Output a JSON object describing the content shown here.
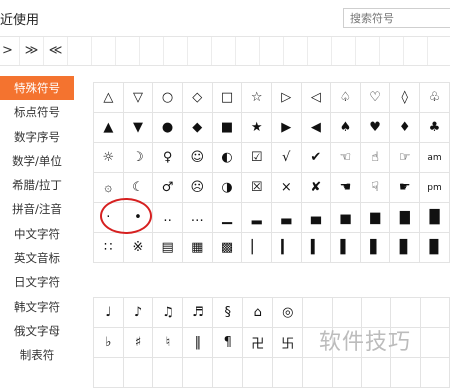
{
  "header": {
    "title": "近使用",
    "search_placeholder": "搜索符号"
  },
  "recent": [
    ">",
    "≫",
    "≪"
  ],
  "sidebar": [
    {
      "label": "特殊符号",
      "active": true
    },
    {
      "label": "标点符号"
    },
    {
      "label": "数字序号"
    },
    {
      "label": "数学/单位"
    },
    {
      "label": "希腊/拉丁"
    },
    {
      "label": "拼音/注音"
    },
    {
      "label": "中文字符"
    },
    {
      "label": "英文音标"
    },
    {
      "label": "日文字符"
    },
    {
      "label": "韩文字符"
    },
    {
      "label": "俄文字母"
    },
    {
      "label": "制表符"
    }
  ],
  "grid1": [
    [
      "△",
      "▽",
      "○",
      "◇",
      "□",
      "☆",
      "▷",
      "◁",
      "♤",
      "♡",
      "◊",
      "♧"
    ],
    [
      "▲",
      "▼",
      "●",
      "◆",
      "■",
      "★",
      "▶",
      "◀",
      "♠",
      "♥",
      "♦",
      "♣"
    ],
    [
      "☼",
      "☽",
      "♀",
      "☺",
      "◐",
      "☑",
      "√",
      "✔",
      "☜",
      "☝",
      "☞",
      "am"
    ],
    [
      "۞",
      "☾",
      "♂",
      "☹",
      "◑",
      "☒",
      "×",
      "✘",
      "☚",
      "☟",
      "☛",
      "pm"
    ],
    [
      "·",
      "•",
      "‥",
      "…",
      "▁",
      "▂",
      "▃",
      "▄",
      "▅",
      "▆",
      "▇",
      "█"
    ],
    [
      "∷",
      "※",
      "▤",
      "▦",
      "▩",
      "▏",
      "▎",
      "▍",
      "▌",
      "▋",
      "▊",
      "▉"
    ]
  ],
  "grid2": [
    [
      "♩",
      "♪",
      "♫",
      "♬",
      "§",
      "⌂",
      "◎",
      "",
      "",
      "",
      "",
      ""
    ],
    [
      "♭",
      "♯",
      "♮",
      "‖",
      "¶",
      "卍",
      "卐",
      "",
      "",
      "",
      "",
      ""
    ],
    [
      "",
      "",
      "",
      "",
      "",
      "",
      "",
      "",
      "",
      "",
      "",
      ""
    ]
  ],
  "watermark": "软件技巧"
}
